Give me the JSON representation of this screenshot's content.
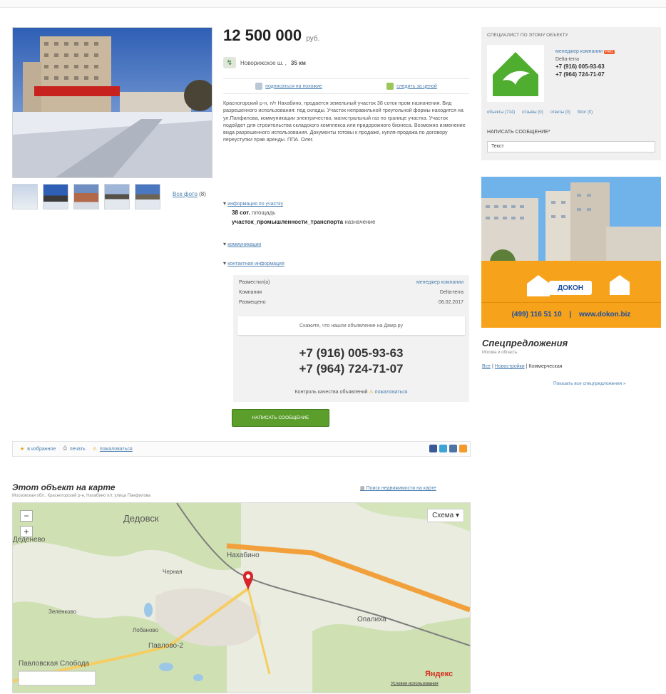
{
  "listing": {
    "price": "12 500 000",
    "currency": "руб.",
    "road": "Новорижское ш. ,",
    "distance": "35 км",
    "subscribe_search": "подписаться на похожие",
    "watch_price": "следить за ценой",
    "description": "Красногорский р-н, п/т Нахабино, продается земельный участок 38 соток пром назначения. Вид разрешенного использования: под склады. Участок неправильной треугольной формы находится на ул.Панфилова, коммуникации электричество, магистральный газ по границе участка. Участок подойдет для строительства складского комплекса или придорожного бизнеса. Возможно изменение вида разрешенного использования. Документы готовы к продаже, купля-продажа по договору переуступки прав аренды. ППА. Олег.",
    "all_photos": "Все фото",
    "all_photos_count": "(8)"
  },
  "specs": {
    "section_plot": "информация по участку",
    "area_value": "38 сот.",
    "area_label": "площадь",
    "purpose_value": "участок_промышленности_транспорта",
    "purpose_label": "назначение",
    "section_communications": "коммуникации",
    "section_contact": "контактная информация"
  },
  "contact_card": {
    "placed_label": "Разместил(а)",
    "placed_value": "менеджер компании",
    "company_label": "Компания",
    "company_value": "Delta-terra",
    "date_label": "Размещено",
    "date_value": "06.02.2017",
    "note": "Скажите, что нашли объявление на Дмир.ру",
    "phone1": "+7 (916) 005-93-63",
    "phone2": "+7 (964) 724-71-07",
    "quality_text": "Контроль качества объявлений",
    "complain": "пожаловаться"
  },
  "write_button": "НАПИСАТЬ СООБЩЕНИЕ",
  "actions": {
    "favorites": "в избранное",
    "print": "печать",
    "complain": "пожаловаться"
  },
  "map": {
    "title": "Этот объект на карте",
    "subtitle": "Московская обл., Красногорский р-н, Нахабино п/т, улица Панфилова",
    "search_link": "Поиск недвижимости на карте",
    "scheme_btn": "Схема",
    "labels": {
      "dedovsk": "Дедовск",
      "nakhabino": "Нахабино",
      "opalikha": "Опалиха",
      "pavlovo2": "Павлово-2",
      "pavlovskaya": "Павловская Слобода",
      "zelenkovo": "Зеленково",
      "lobanovo": "Лобаново",
      "chernaya": "Черная",
      "dedenevo": "Деденево",
      "yandex": "Яндекс",
      "terms": "Условия использования"
    }
  },
  "specialist": {
    "title": "СПЕЦИАЛИСТ ПО ЭТОМУ ОБЪЕКТУ",
    "name": "менеджер компании",
    "badge": "PRO",
    "company": "Delta-terra",
    "phone1": "+7 (916) 005-93-63",
    "phone2": "+7 (964) 724-71-07",
    "links": [
      "объекты (714)",
      "отзывы (0)",
      "ответы (0)",
      "блог (0)"
    ],
    "write_label": "НАПИСАТЬ СООБЩЕНИЕ*",
    "input_value": "Текст"
  },
  "ad": {
    "brand": "ДОКОН",
    "phone": "(499) 116 51 10",
    "site": "www.dokon.biz"
  },
  "offers": {
    "title": "Спецпредложения",
    "region": "Москва и область",
    "link_all": "Все",
    "link_new": "Новостройки",
    "current": "Коммерческая",
    "show_all": "Показать все спецпредложения »"
  },
  "colors": {
    "link": "#4a7fb0",
    "green_button": "#5b9e2c",
    "ad_orange": "#f7a21b",
    "logo_green": "#4fae2f"
  }
}
